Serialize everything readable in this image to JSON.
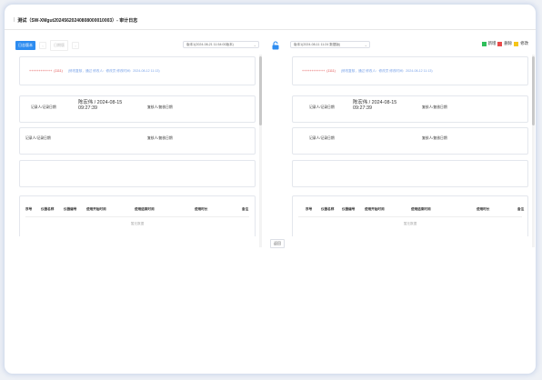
{
  "window": {
    "title": "测试（SW-XMgut20245620240808000010003）- 审计日志"
  },
  "toolbar": {
    "primary_label": "日志版本",
    "secondary_label": "日期版"
  },
  "left": {
    "version_select": "版本1(2024-08-21 11:54:00版本)",
    "log": {
      "name": "++++++++++++",
      "id": "(1111)",
      "desc": "(修改复核，通过 修改人：修改员 修改时间：2024-08-12 11:13)"
    },
    "record": {
      "label1": "记录人/记录日期",
      "value1": "陈宏伟 / 2024-08-15 09:27:39",
      "label2": "复核人/复核日期"
    },
    "record2": {
      "label1": "记录人/记录日期",
      "label2": "复核人/复核日期"
    },
    "table": {
      "columns": [
        "序号",
        "仪器名称",
        "仪器编号",
        "使用开始时间",
        "使用结束时间",
        "使用时长",
        "备注"
      ],
      "empty_text": "暂无数据"
    }
  },
  "right": {
    "version_select": "版本1(2024-08-11 11:24 数据版)",
    "log": {
      "name": "++++++++++++",
      "id": "(1111)",
      "desc": "(修改复核，通过 修改人：修改员 修改时间：2024-08-12 11:13)"
    },
    "record": {
      "label1": "记录人/记录日期",
      "value1": "陈宏伟 / 2024-08-15 09:27:39",
      "label2": "复核人/复核日期"
    },
    "record2": {
      "label1": "记录人/记录日期",
      "label2": "复核人/复核日期"
    },
    "table": {
      "columns": [
        "序号",
        "仪器名称",
        "仪器编号",
        "使用开始时间",
        "使用结束时间",
        "使用时长",
        "备注"
      ],
      "empty_text": "暂无数据"
    }
  },
  "legend": {
    "items": [
      {
        "label": "新增",
        "color": "#2fbf5b"
      },
      {
        "label": "删除",
        "color": "#e84a4a"
      },
      {
        "label": "修改",
        "color": "#f5c518"
      }
    ]
  },
  "footer": {
    "back_label": "返回"
  }
}
